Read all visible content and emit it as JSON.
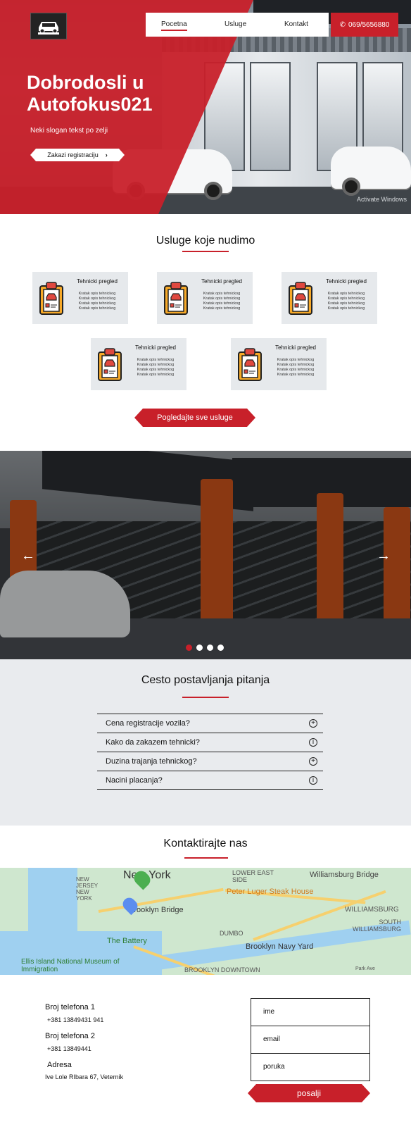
{
  "header": {
    "logo_icon": "car-logo-icon",
    "nav": [
      {
        "label": "Pocetna",
        "active": true
      },
      {
        "label": "Usluge",
        "active": false
      },
      {
        "label": "Kontakt",
        "active": false
      }
    ],
    "phone": "069/5656880"
  },
  "hero": {
    "title": "Dobrodosli u Autofokus021",
    "subtitle": "Neki slogan tekst po zelji",
    "cta_label": "Zakazi registraciju",
    "watermark": "Activate Windows"
  },
  "services": {
    "title": "Usluge koje nudimo",
    "cards": [
      {
        "title": "Tehnicki pregled",
        "desc": [
          "Kratak opis tehnickog",
          "Kratak opis tehnickog",
          "Kratak opis tehnickog",
          "Kratak opis tehnickog"
        ]
      },
      {
        "title": "Tehnicki pregled",
        "desc": [
          "Kratak opis tehnickog",
          "Kratak opis tehnickog",
          "Kratak opis tehnickog",
          "Kratak opis tehnickog"
        ]
      },
      {
        "title": "Tehnicki pregled",
        "desc": [
          "Kratak opis tehnickog",
          "Kratak opis tehnickog",
          "Kratak opis tehnickog",
          "Kratak opis tehnickog"
        ]
      },
      {
        "title": "Tehnicki pregled",
        "desc": [
          "Kratak opis tehnickog",
          "Kratak opis tehnickog",
          "Kratak opis tehnickog",
          "Kratak opis tehnickog"
        ]
      },
      {
        "title": "Tehnicki pregled",
        "desc": [
          "Kratak opis tehnickog",
          "Kratak opis tehnickog",
          "Kratak opis tehnickog",
          "Kratak opis tehnickog"
        ]
      }
    ],
    "all_label": "Pogledajte sve usluge"
  },
  "carousel": {
    "prev_icon": "arrow-left-icon",
    "next_icon": "arrow-right-icon",
    "slides": 4,
    "active_slide": 1
  },
  "faq": {
    "title": "Cesto postavljanja pitanja",
    "items": [
      {
        "q": "Cena registracije vozila?",
        "icon": "+"
      },
      {
        "q": "Kako da zakazem tehnicki?",
        "icon": "i"
      },
      {
        "q": "Duzina trajanja tehnickog?",
        "icon": "+"
      },
      {
        "q": "Nacini placanja?",
        "icon": "i"
      }
    ]
  },
  "contact": {
    "title": "Kontaktirajte nas",
    "map_labels": [
      "New York",
      "LOWER EAST SIDE",
      "Williamsburg Bridge",
      "Peter Luger Steak House",
      "WILLIAMSBURG",
      "Brooklyn Bridge",
      "SOUTH WILLIAMSBURG",
      "The Battery",
      "DUMBO",
      "Brooklyn Navy Yard",
      "NEW JERSEY NEW YORK",
      "Ellis Island National Museum of Immigration",
      "BROOKLYN DOWNTOWN",
      "Park Ave"
    ],
    "phone1_label": "Broj telefona 1",
    "phone1": "+381 13849431 941",
    "phone2_label": "Broj telefona 2",
    "phone2": "+381 13849441",
    "address_label": "Adresa",
    "address": "Ive Lole RIbara 67, Veternik",
    "form": {
      "name": "ime",
      "email": "email",
      "message": "poruka",
      "submit": "posalji"
    }
  },
  "colors": {
    "accent": "#c8202a",
    "light_gray": "#e9ebee"
  }
}
